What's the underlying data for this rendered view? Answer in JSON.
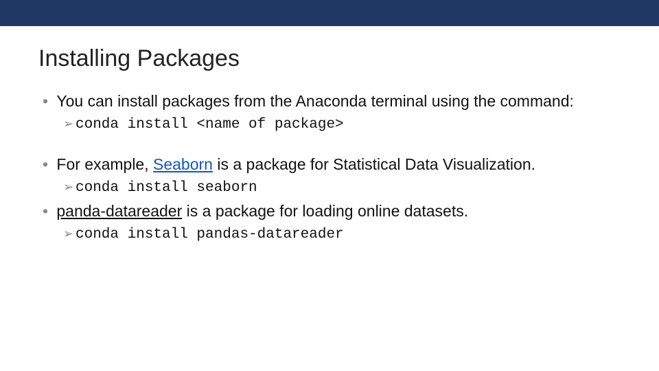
{
  "title": "Installing Packages",
  "bullets": [
    {
      "text_pre": "You can install packages from the Anaconda terminal using the command:",
      "code": "conda install <name of package>"
    },
    {
      "text_pre": "For example, ",
      "link_text": "Seaborn",
      "text_post": " is a package for Statistical Data Visualization.",
      "code": "conda install seaborn"
    },
    {
      "link_text": "panda-datareader",
      "text_post": " is a package for loading online datasets.",
      "code": "conda install pandas-datareader"
    }
  ]
}
